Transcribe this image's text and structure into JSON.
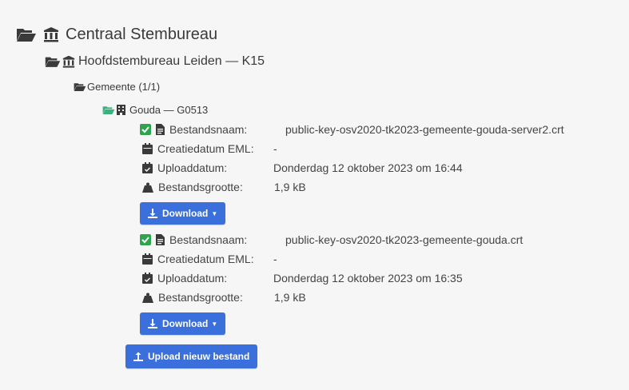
{
  "tree": {
    "root_label": "Centraal Stembureau",
    "hsb_label": "Hoofdstembureau Leiden — K15",
    "gemeente_label": "Gemeente (1/1)",
    "gouda_label": "Gouda — G0513"
  },
  "labels": {
    "bestandsnaam": "Bestandsnaam:",
    "creatiedatum": "Creatiedatum EML:",
    "uploaddatum": "Uploaddatum:",
    "bestandsgrootte": "Bestandsgrootte:"
  },
  "files": [
    {
      "name": "public-key-osv2020-tk2023-gemeente-gouda-server2.crt",
      "created": "-",
      "uploaded": "Donderdag 12 oktober 2023 om 16:44",
      "size": "1,9 kB",
      "download_label": "Download"
    },
    {
      "name": "public-key-osv2020-tk2023-gemeente-gouda.crt",
      "created": "-",
      "uploaded": "Donderdag 12 oktober 2023 om 16:35",
      "size": "1,9 kB",
      "download_label": "Download"
    }
  ],
  "upload_button_label": "Upload nieuw bestand",
  "colors": {
    "folder_dark": "#3a3a3a",
    "folder_green": "#36b37e",
    "check_green": "#2ea44f",
    "button_blue": "#3a6fdc",
    "background": "#f6f6f6"
  },
  "icons": {
    "folder": "folder-open-icon",
    "building": "landmark-icon",
    "check": "check-square-icon",
    "file": "file-icon",
    "calendar": "calendar-icon",
    "calendar_check": "calendar-check-icon",
    "weight": "weight-icon",
    "download": "download-icon",
    "upload": "upload-icon"
  }
}
